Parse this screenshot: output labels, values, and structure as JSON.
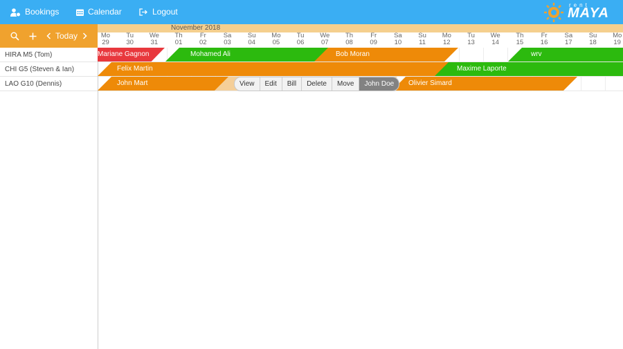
{
  "nav": {
    "bookings": "Bookings",
    "calendar": "Calendar",
    "logout": "Logout"
  },
  "logo": {
    "small": "rent",
    "main": "MAYA"
  },
  "toolbar": {
    "today": "Today"
  },
  "month": "November 2018",
  "days": [
    {
      "d": "Mo",
      "n": "29"
    },
    {
      "d": "Tu",
      "n": "30"
    },
    {
      "d": "We",
      "n": "31"
    },
    {
      "d": "Th",
      "n": "01"
    },
    {
      "d": "Fr",
      "n": "02"
    },
    {
      "d": "Sa",
      "n": "03"
    },
    {
      "d": "Su",
      "n": "04"
    },
    {
      "d": "Mo",
      "n": "05"
    },
    {
      "d": "Tu",
      "n": "06"
    },
    {
      "d": "We",
      "n": "07"
    },
    {
      "d": "Th",
      "n": "08"
    },
    {
      "d": "Fr",
      "n": "09"
    },
    {
      "d": "Sa",
      "n": "10"
    },
    {
      "d": "Su",
      "n": "11"
    },
    {
      "d": "Mo",
      "n": "12"
    },
    {
      "d": "Tu",
      "n": "13"
    },
    {
      "d": "We",
      "n": "14"
    },
    {
      "d": "Th",
      "n": "15"
    },
    {
      "d": "Fr",
      "n": "16"
    },
    {
      "d": "Sa",
      "n": "17"
    },
    {
      "d": "Su",
      "n": "18"
    },
    {
      "d": "Mo",
      "n": "19"
    }
  ],
  "resources": [
    "HIRA M5 (Tom)",
    "CHI G5 (Steven & Ian)",
    "LAO G10 (Dennis)"
  ],
  "bookings": [
    {
      "name": "Mariane Gagnon",
      "color": "#e8383d"
    },
    {
      "name": "Mohamed Ali",
      "color": "#2cba0e"
    },
    {
      "name": "Bob Moran",
      "color": "#ee8a08"
    },
    {
      "name": "wrv",
      "color": "#2cba0e"
    },
    {
      "name": "Felix Martin",
      "color": "#ee8a08"
    },
    {
      "name": "Maxime Laporte",
      "color": "#2cba0e"
    },
    {
      "name": "John Mart",
      "color": "#ee8a08"
    },
    {
      "name": "John Doe",
      "color": "#f5cf98"
    },
    {
      "name": "Olivier Simard",
      "color": "#ee8a08"
    }
  ],
  "context_menu": [
    "View",
    "Edit",
    "Bill",
    "Delete",
    "Move",
    "John Doe"
  ]
}
